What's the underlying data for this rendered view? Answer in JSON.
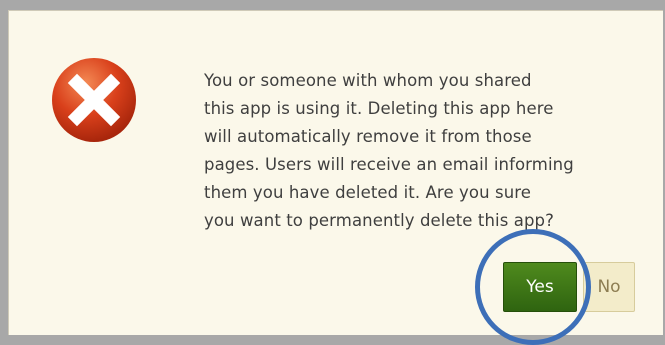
{
  "dialog": {
    "icon": "error-x-icon",
    "message_lines": [
      "You or someone with whom you shared",
      "this app is using it. Deleting this app here",
      "will automatically remove it from those",
      "pages. Users will receive an email informing",
      "them you have deleted it. Are you sure",
      "you want to permanently delete this app?"
    ],
    "buttons": {
      "yes_label": "Yes",
      "no_label": "No"
    }
  },
  "colors": {
    "icon_red": "#d9401b",
    "yes_green": "#3a7416",
    "annotation_ring": "#3d6fb8",
    "background": "#fbf8ea"
  }
}
